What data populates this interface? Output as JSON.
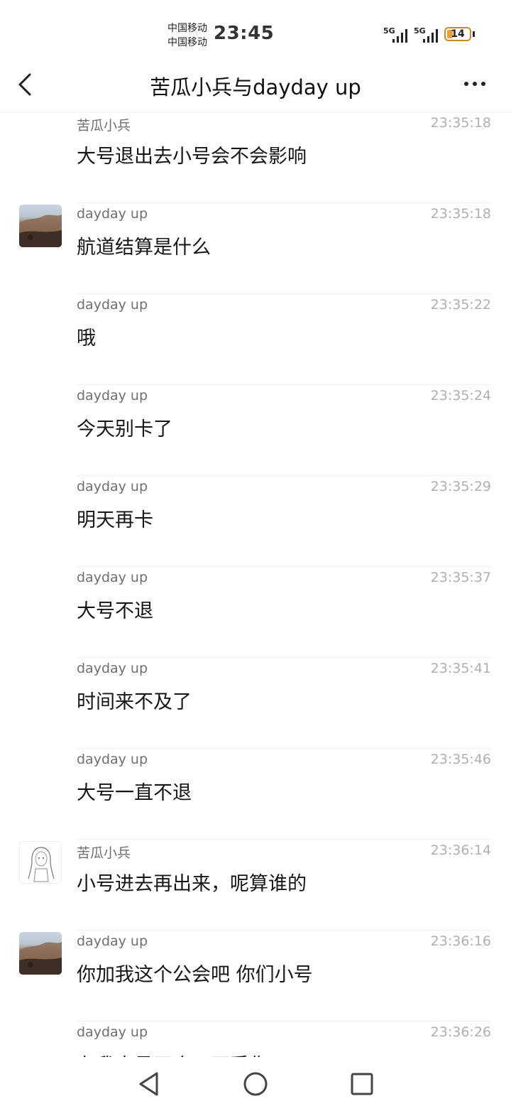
{
  "status_bar": {
    "carrier1": "中国移动",
    "carrier2": "中国移动",
    "time": "23:45",
    "signal1": "5G",
    "signal2": "5G",
    "battery": "14"
  },
  "header": {
    "back_icon": "chevron-left-icon",
    "title": "苦瓜小兵与dayday up",
    "more_icon": "more-dots-icon"
  },
  "messages": [
    {
      "sender": "苦瓜小兵",
      "time": "23:35:18",
      "text": "大号退出去小号会不会影响",
      "avatar": ""
    },
    {
      "sender": "dayday up",
      "time": "23:35:18",
      "text": "航道结算是什么",
      "avatar": "landscape-avatar"
    },
    {
      "sender": "dayday up",
      "time": "23:35:22",
      "text": "哦",
      "avatar": ""
    },
    {
      "sender": "dayday up",
      "time": "23:35:24",
      "text": "今天别卡了",
      "avatar": ""
    },
    {
      "sender": "dayday up",
      "time": "23:35:29",
      "text": "明天再卡",
      "avatar": ""
    },
    {
      "sender": "dayday up",
      "time": "23:35:37",
      "text": "大号不退",
      "avatar": ""
    },
    {
      "sender": "dayday up",
      "time": "23:35:41",
      "text": "时间来不及了",
      "avatar": ""
    },
    {
      "sender": "dayday up",
      "time": "23:35:46",
      "text": "大号一直不退",
      "avatar": ""
    },
    {
      "sender": "苦瓜小兵",
      "time": "23:36:14",
      "text": "小号进去再出来，呢算谁的",
      "avatar": "sketch-girl-avatar"
    },
    {
      "sender": "dayday up",
      "time": "23:36:16",
      "text": "你加我这个公会吧 你们小号",
      "avatar": "landscape-avatar"
    },
    {
      "sender": "dayday up",
      "time": "23:36:26",
      "text": "在我大号不会用不受伤",
      "avatar": ""
    }
  ],
  "nav_bar": {
    "back": "triangle-back-icon",
    "home": "circle-home-icon",
    "recents": "square-recents-icon"
  },
  "colors": {
    "sender": "#6f6f6f",
    "timestamp": "#b0b0b0",
    "message": "#161616",
    "battery": "#e8a13a"
  }
}
